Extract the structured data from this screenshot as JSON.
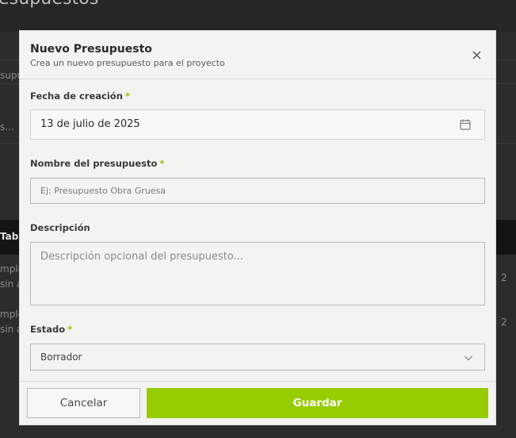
{
  "background": {
    "page_title": "esupuestos",
    "fragments": [
      "supu",
      "s...",
      "Tab",
      "mple",
      "sin a",
      "mple",
      "sin a",
      "2",
      "2"
    ]
  },
  "modal": {
    "title": "Nuevo Presupuesto",
    "subtitle": "Crea un nuevo presupuesto para el proyecto",
    "fields": {
      "date": {
        "label": "Fecha de creación",
        "required_mark": "*",
        "value": "13 de julio de 2025"
      },
      "name": {
        "label": "Nombre del presupuesto",
        "required_mark": "*",
        "placeholder": "Ej: Presupuesto Obra Gruesa"
      },
      "description": {
        "label": "Descripción",
        "placeholder": "Descripción opcional del presupuesto..."
      },
      "status": {
        "label": "Estado",
        "required_mark": "*",
        "selected": "Borrador"
      }
    },
    "buttons": {
      "cancel": "Cancelar",
      "save": "Guardar"
    }
  },
  "colors": {
    "accent": "#96cc00",
    "required": "#96c400"
  },
  "icons": {
    "close": "close-icon",
    "calendar": "calendar-icon",
    "chevron": "chevron-down-icon"
  }
}
